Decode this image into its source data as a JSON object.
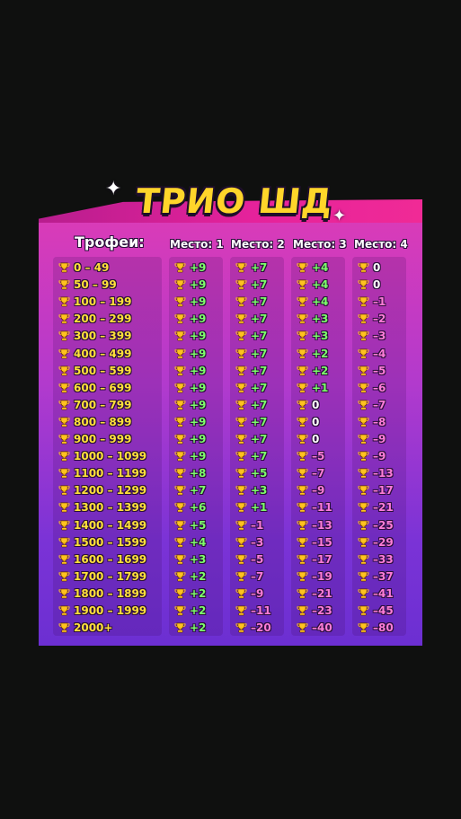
{
  "title": "ТРИО ШД",
  "headers": {
    "trophies": "Трофеи:",
    "places": [
      "Место: 1",
      "Место: 2",
      "Место: 3",
      "Место: 4"
    ]
  },
  "colors": {
    "positive": "#7dff6a",
    "negative": "#ff7dd8",
    "zero": "#ffffff",
    "range": "#ffe13a",
    "title": "#ffd52a"
  },
  "icon": "trophy-icon",
  "rows": [
    {
      "range": "0 – 49",
      "values": [
        "+9",
        "+7",
        "+4",
        "0"
      ]
    },
    {
      "range": "50 – 99",
      "values": [
        "+9",
        "+7",
        "+4",
        "0"
      ]
    },
    {
      "range": "100 – 199",
      "values": [
        "+9",
        "+7",
        "+4",
        "–1"
      ]
    },
    {
      "range": "200 – 299",
      "values": [
        "+9",
        "+7",
        "+3",
        "–2"
      ]
    },
    {
      "range": "300 – 399",
      "values": [
        "+9",
        "+7",
        "+3",
        "–3"
      ]
    },
    {
      "range": "400 – 499",
      "values": [
        "+9",
        "+7",
        "+2",
        "–4"
      ]
    },
    {
      "range": "500 – 599",
      "values": [
        "+9",
        "+7",
        "+2",
        "–5"
      ]
    },
    {
      "range": "600 – 699",
      "values": [
        "+9",
        "+7",
        "+1",
        "–6"
      ]
    },
    {
      "range": "700 – 799",
      "values": [
        "+9",
        "+7",
        "0",
        "–7"
      ]
    },
    {
      "range": "800 – 899",
      "values": [
        "+9",
        "+7",
        "0",
        "–8"
      ]
    },
    {
      "range": "900 – 999",
      "values": [
        "+9",
        "+7",
        "0",
        "–9"
      ]
    },
    {
      "range": "1000 – 1099",
      "values": [
        "+9",
        "+7",
        "–5",
        "–9"
      ]
    },
    {
      "range": "1100 – 1199",
      "values": [
        "+8",
        "+5",
        "–7",
        "–13"
      ]
    },
    {
      "range": "1200 – 1299",
      "values": [
        "+7",
        "+3",
        "–9",
        "–17"
      ]
    },
    {
      "range": "1300 – 1399",
      "values": [
        "+6",
        "+1",
        "–11",
        "–21"
      ]
    },
    {
      "range": "1400 – 1499",
      "values": [
        "+5",
        "–1",
        "–13",
        "–25"
      ]
    },
    {
      "range": "1500 – 1599",
      "values": [
        "+4",
        "–3",
        "–15",
        "–29"
      ]
    },
    {
      "range": "1600 – 1699",
      "values": [
        "+3",
        "–5",
        "–17",
        "–33"
      ]
    },
    {
      "range": "1700 – 1799",
      "values": [
        "+2",
        "–7",
        "–19",
        "–37"
      ]
    },
    {
      "range": "1800 – 1899",
      "values": [
        "+2",
        "–9",
        "–21",
        "–41"
      ]
    },
    {
      "range": "1900 – 1999",
      "values": [
        "+2",
        "–11",
        "–23",
        "–45"
      ]
    },
    {
      "range": "2000+",
      "values": [
        "+2",
        "–20",
        "–40",
        "–80"
      ]
    }
  ]
}
